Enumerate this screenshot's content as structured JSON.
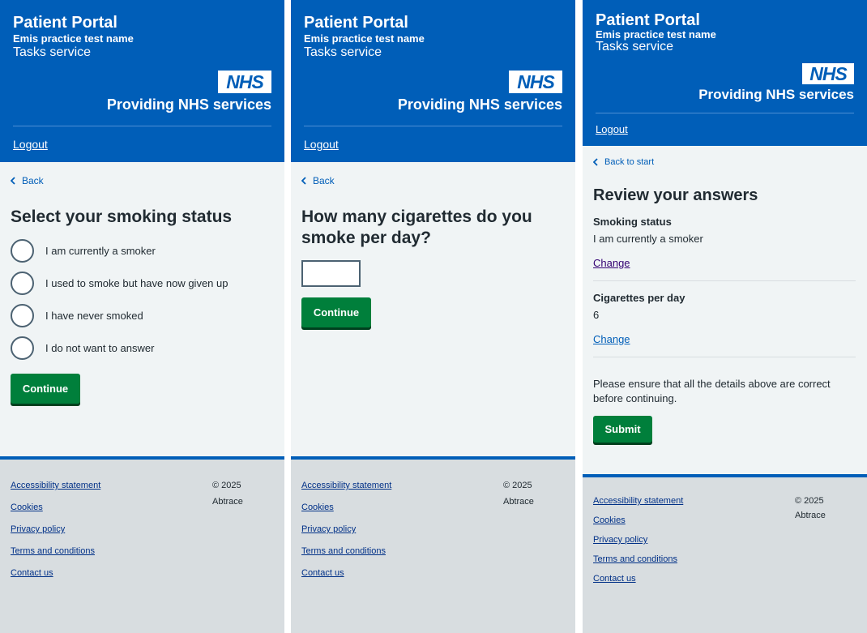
{
  "header": {
    "portal_title": "Patient Portal",
    "practice_name": "Emis practice test name",
    "service_name": "Tasks service",
    "logo_text": "NHS",
    "providing": "Providing NHS services",
    "logout": "Logout"
  },
  "screen1": {
    "back": "Back",
    "heading": "Select your smoking status",
    "options": [
      "I am currently a smoker",
      "I used to smoke but have now given up",
      "I have never smoked",
      "I do not want to answer"
    ],
    "continue": "Continue"
  },
  "screen2": {
    "back": "Back",
    "heading_line1": "How many cigarettes do you",
    "heading_line2": "smoke per day?",
    "input_value": "",
    "continue": "Continue"
  },
  "screen3": {
    "back": "Back to start",
    "heading": "Review your answers",
    "rows": [
      {
        "label": "Smoking status",
        "value": "I am currently a smoker",
        "change": "Change"
      },
      {
        "label": "Cigarettes per day",
        "value": "6",
        "change": "Change"
      }
    ],
    "note_line1": "Please ensure that all the details above are correct",
    "note_line2": "before continuing.",
    "submit": "Submit"
  },
  "footer": {
    "links": [
      "Accessibility statement",
      "Cookies",
      "Privacy policy",
      "Terms and conditions",
      "Contact us"
    ],
    "copyright": "© 2025",
    "company": "Abtrace"
  },
  "colors": {
    "nhs_blue": "#005eb8",
    "button_green": "#007f3b",
    "page_bg": "#f0f4f5",
    "footer_bg": "#d8dde0",
    "visited_link": "#330072"
  }
}
